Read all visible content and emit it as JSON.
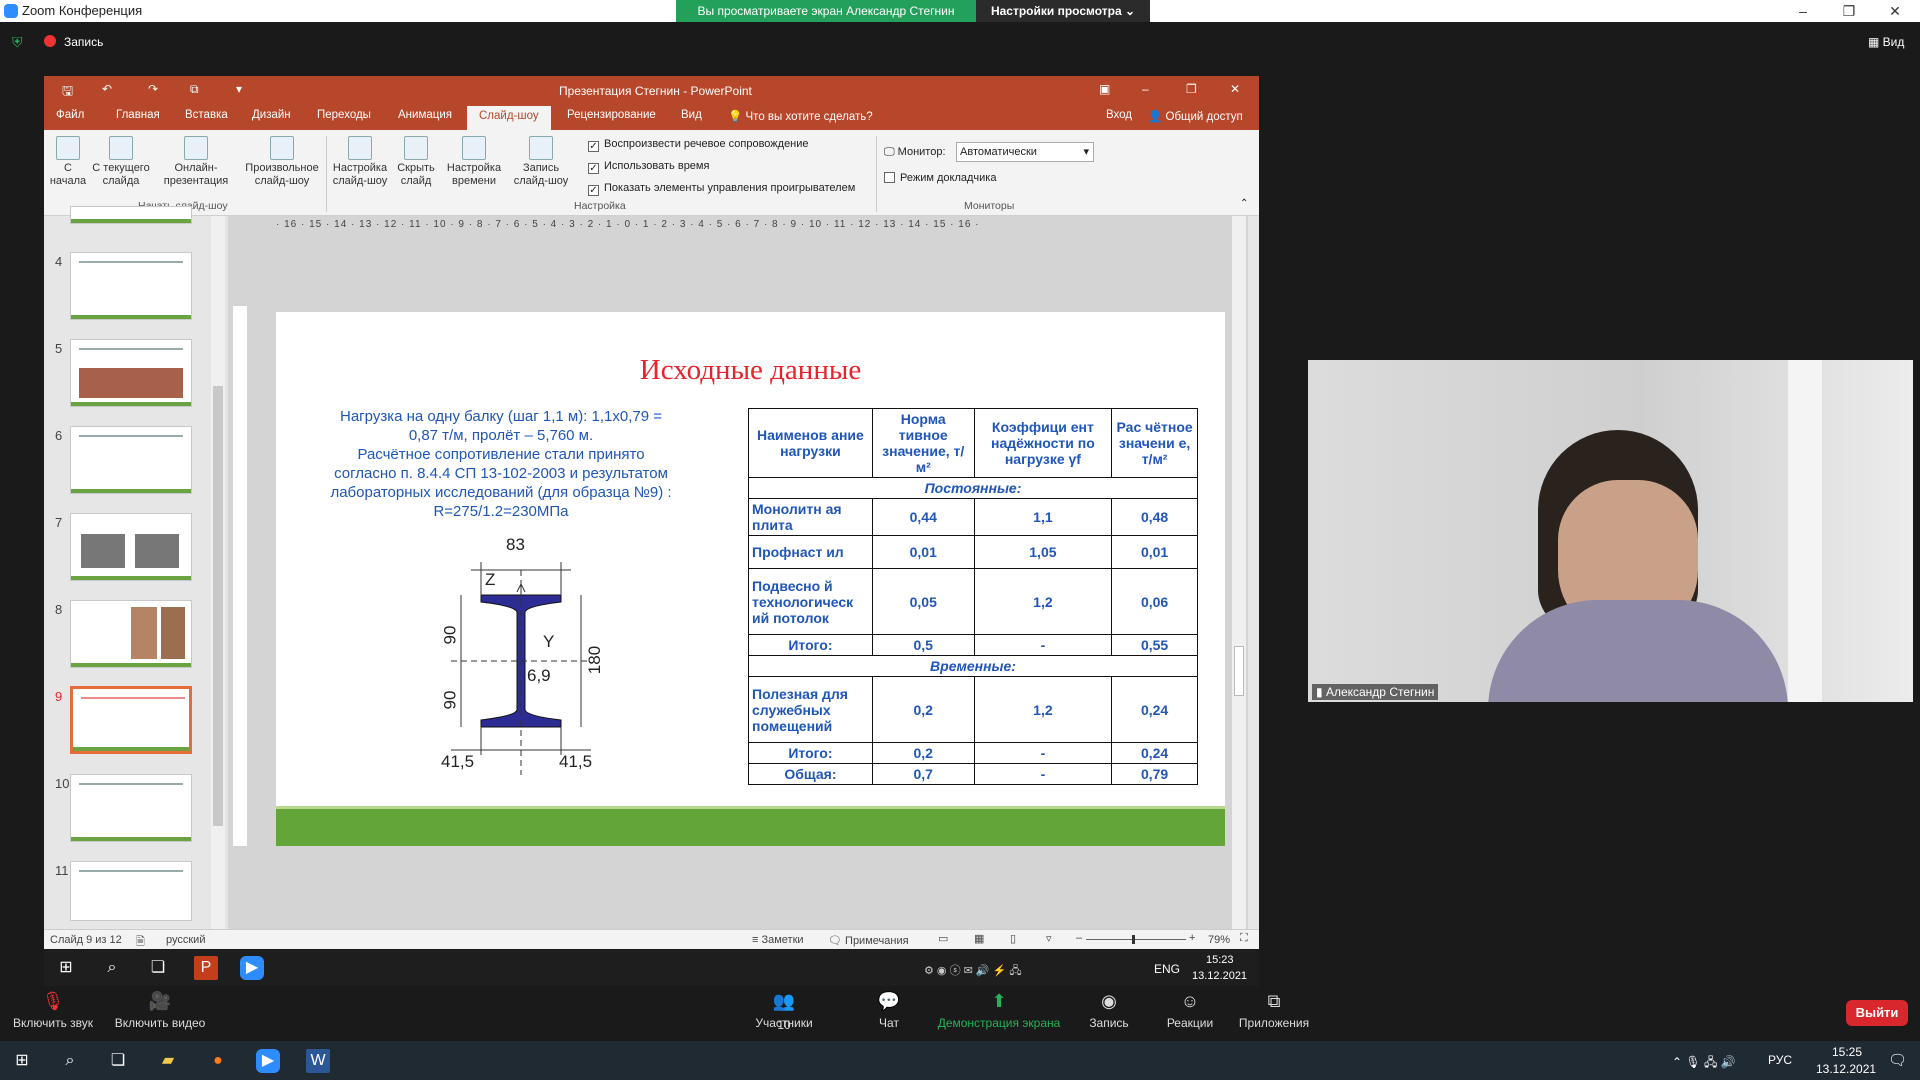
{
  "zoom": {
    "window_title": "Zoom Конференция",
    "share_banner": "Вы просматриваете экран Александр Стегнин",
    "view_options": "Настройки просмотра",
    "recording": "Запись",
    "view_btn": "Вид"
  },
  "ppt": {
    "title": "Презентация Стегнин - PowerPoint",
    "tabs": [
      "Файл",
      "Главная",
      "Вставка",
      "Дизайн",
      "Переходы",
      "Анимация",
      "Слайд-шоу",
      "Рецензирование",
      "Вид"
    ],
    "tellme": "Что вы хотите сделать?",
    "signin": "Вход",
    "share": "Общий доступ",
    "ribbon": {
      "btn_start": "С начала",
      "btn_current": "С текущего слайда",
      "btn_online": "Онлайн-презентация",
      "btn_custom": "Произвольное слайд-шоу",
      "btn_setup": "Настройка слайд-шоу",
      "btn_hide": "Скрыть слайд",
      "btn_timing": "Настройка времени",
      "btn_record": "Запись слайд-шоу",
      "grp_start": "Начать слайд-шоу",
      "grp_setup": "Настройка",
      "grp_monitors": "Мониторы",
      "chk_narration": "Воспроизвести речевое сопровождение",
      "chk_timings": "Использовать время",
      "chk_controls": "Показать элементы управления проигрывателем",
      "monitor_label": "Монитор:",
      "monitor_value": "Автоматически",
      "presenter_view": "Режим докладчика"
    },
    "ruler": "· 16 · 15 · 14 · 13 · 12 · 11 · 10 · 9 · 8 · 7 · 6 · 5 · 4 · 3 · 2 · 1 · 0 · 1 · 2 · 3 · 4 · 5 · 6 · 7 · 8 · 9 · 10 · 11 · 12 · 13 · 14 · 15 · 16 ·",
    "thumb_numbers": [
      "4",
      "5",
      "6",
      "7",
      "8",
      "9",
      "10",
      "11"
    ],
    "status": {
      "slide": "Слайд 9 из 12",
      "lang": "русский",
      "notes": "Заметки",
      "comments": "Примечания",
      "zoom": "79%"
    }
  },
  "slide": {
    "title": "Исходные данные",
    "text1": "Нагрузка на одну балку (шаг 1,1 м): 1,1х0,79 = 0,87 т/м, пролёт – 5,760 м.",
    "text2": "Расчётное сопротивление стали принято согласно п. 8.4.4 СП 13-102-2003 и результатом лабораторных исследований (для образца №9) : R=275/1.2=230МПа",
    "beam": {
      "top": "83",
      "h1": "90",
      "h2": "90",
      "total": "180",
      "web": "6,9",
      "left": "41,5",
      "right": "41,5",
      "z": "Z",
      "y": "Y"
    },
    "table": {
      "h1": "Наименов ание нагрузки",
      "h2": "Норма тивное значение, т/м²",
      "h3": "Коэффици ент надёжности по нагрузке γf",
      "h4": "Рас чётное значени е, т/м²",
      "sec1": "Постоянные:",
      "r1": [
        "Монолитн ая плита",
        "0,44",
        "1,1",
        "0,48"
      ],
      "r2": [
        "Профнаст ил",
        "0,01",
        "1,05",
        "0,01"
      ],
      "r3": [
        "Подвесно й технологическ ий потолок",
        "0,05",
        "1,2",
        "0,06"
      ],
      "r4": [
        "Итого:",
        "0,5",
        "-",
        "0,55"
      ],
      "sec2": "Временные:",
      "r5": [
        "Полезная для служебных помещений",
        "0,2",
        "1,2",
        "0,24"
      ],
      "r6": [
        "Итого:",
        "0,2",
        "-",
        "0,24"
      ],
      "r7": [
        "Общая:",
        "0,7",
        "-",
        "0,79"
      ]
    }
  },
  "remote_taskbar": {
    "lang": "ENG",
    "time": "15:23",
    "date": "13.12.2021"
  },
  "video": {
    "name": "Александр Стегнин"
  },
  "controls": {
    "audio": "Включить звук",
    "video": "Включить видео",
    "participants": "Участники",
    "participants_count": "10",
    "chat": "Чат",
    "share": "Демонстрация экрана",
    "record": "Запись",
    "reactions": "Реакции",
    "apps": "Приложения",
    "exit": "Выйти"
  },
  "os_taskbar": {
    "lang": "РУС",
    "time": "15:25",
    "date": "13.12.2021"
  }
}
